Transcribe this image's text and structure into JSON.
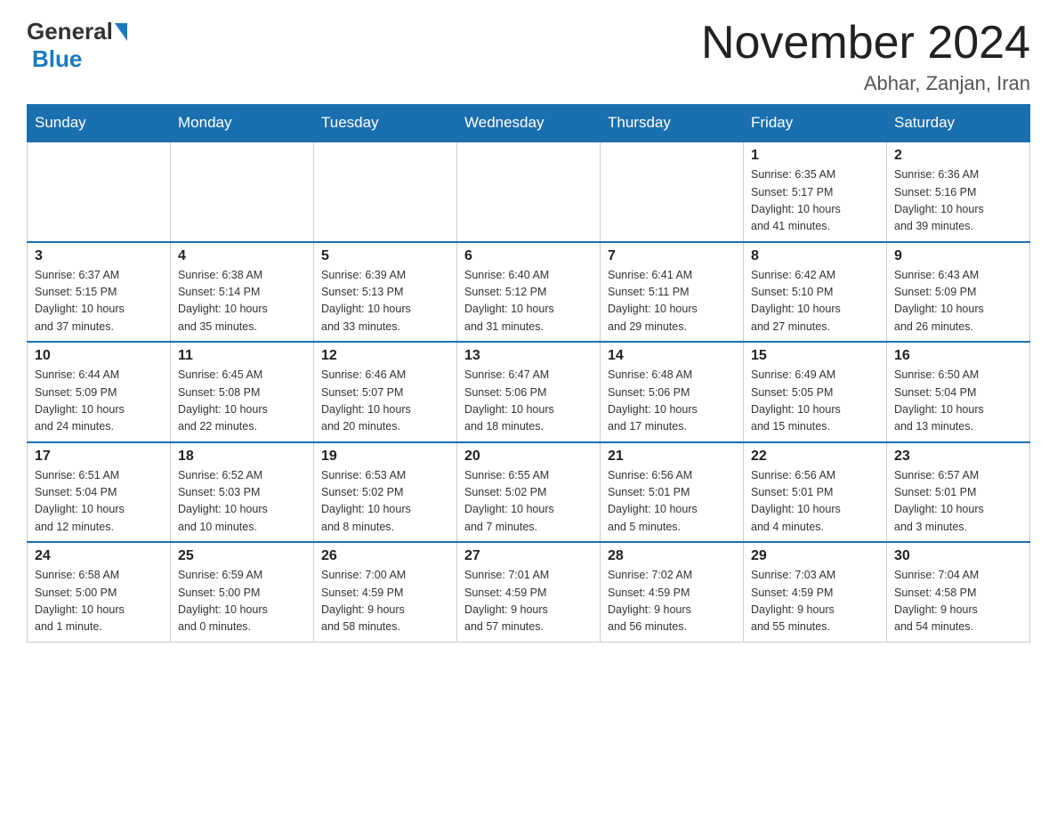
{
  "header": {
    "logo_general": "General",
    "logo_blue": "Blue",
    "month_year": "November 2024",
    "location": "Abhar, Zanjan, Iran"
  },
  "weekdays": [
    "Sunday",
    "Monday",
    "Tuesday",
    "Wednesday",
    "Thursday",
    "Friday",
    "Saturday"
  ],
  "weeks": [
    [
      {
        "day": "",
        "info": ""
      },
      {
        "day": "",
        "info": ""
      },
      {
        "day": "",
        "info": ""
      },
      {
        "day": "",
        "info": ""
      },
      {
        "day": "",
        "info": ""
      },
      {
        "day": "1",
        "info": "Sunrise: 6:35 AM\nSunset: 5:17 PM\nDaylight: 10 hours\nand 41 minutes."
      },
      {
        "day": "2",
        "info": "Sunrise: 6:36 AM\nSunset: 5:16 PM\nDaylight: 10 hours\nand 39 minutes."
      }
    ],
    [
      {
        "day": "3",
        "info": "Sunrise: 6:37 AM\nSunset: 5:15 PM\nDaylight: 10 hours\nand 37 minutes."
      },
      {
        "day": "4",
        "info": "Sunrise: 6:38 AM\nSunset: 5:14 PM\nDaylight: 10 hours\nand 35 minutes."
      },
      {
        "day": "5",
        "info": "Sunrise: 6:39 AM\nSunset: 5:13 PM\nDaylight: 10 hours\nand 33 minutes."
      },
      {
        "day": "6",
        "info": "Sunrise: 6:40 AM\nSunset: 5:12 PM\nDaylight: 10 hours\nand 31 minutes."
      },
      {
        "day": "7",
        "info": "Sunrise: 6:41 AM\nSunset: 5:11 PM\nDaylight: 10 hours\nand 29 minutes."
      },
      {
        "day": "8",
        "info": "Sunrise: 6:42 AM\nSunset: 5:10 PM\nDaylight: 10 hours\nand 27 minutes."
      },
      {
        "day": "9",
        "info": "Sunrise: 6:43 AM\nSunset: 5:09 PM\nDaylight: 10 hours\nand 26 minutes."
      }
    ],
    [
      {
        "day": "10",
        "info": "Sunrise: 6:44 AM\nSunset: 5:09 PM\nDaylight: 10 hours\nand 24 minutes."
      },
      {
        "day": "11",
        "info": "Sunrise: 6:45 AM\nSunset: 5:08 PM\nDaylight: 10 hours\nand 22 minutes."
      },
      {
        "day": "12",
        "info": "Sunrise: 6:46 AM\nSunset: 5:07 PM\nDaylight: 10 hours\nand 20 minutes."
      },
      {
        "day": "13",
        "info": "Sunrise: 6:47 AM\nSunset: 5:06 PM\nDaylight: 10 hours\nand 18 minutes."
      },
      {
        "day": "14",
        "info": "Sunrise: 6:48 AM\nSunset: 5:06 PM\nDaylight: 10 hours\nand 17 minutes."
      },
      {
        "day": "15",
        "info": "Sunrise: 6:49 AM\nSunset: 5:05 PM\nDaylight: 10 hours\nand 15 minutes."
      },
      {
        "day": "16",
        "info": "Sunrise: 6:50 AM\nSunset: 5:04 PM\nDaylight: 10 hours\nand 13 minutes."
      }
    ],
    [
      {
        "day": "17",
        "info": "Sunrise: 6:51 AM\nSunset: 5:04 PM\nDaylight: 10 hours\nand 12 minutes."
      },
      {
        "day": "18",
        "info": "Sunrise: 6:52 AM\nSunset: 5:03 PM\nDaylight: 10 hours\nand 10 minutes."
      },
      {
        "day": "19",
        "info": "Sunrise: 6:53 AM\nSunset: 5:02 PM\nDaylight: 10 hours\nand 8 minutes."
      },
      {
        "day": "20",
        "info": "Sunrise: 6:55 AM\nSunset: 5:02 PM\nDaylight: 10 hours\nand 7 minutes."
      },
      {
        "day": "21",
        "info": "Sunrise: 6:56 AM\nSunset: 5:01 PM\nDaylight: 10 hours\nand 5 minutes."
      },
      {
        "day": "22",
        "info": "Sunrise: 6:56 AM\nSunset: 5:01 PM\nDaylight: 10 hours\nand 4 minutes."
      },
      {
        "day": "23",
        "info": "Sunrise: 6:57 AM\nSunset: 5:01 PM\nDaylight: 10 hours\nand 3 minutes."
      }
    ],
    [
      {
        "day": "24",
        "info": "Sunrise: 6:58 AM\nSunset: 5:00 PM\nDaylight: 10 hours\nand 1 minute."
      },
      {
        "day": "25",
        "info": "Sunrise: 6:59 AM\nSunset: 5:00 PM\nDaylight: 10 hours\nand 0 minutes."
      },
      {
        "day": "26",
        "info": "Sunrise: 7:00 AM\nSunset: 4:59 PM\nDaylight: 9 hours\nand 58 minutes."
      },
      {
        "day": "27",
        "info": "Sunrise: 7:01 AM\nSunset: 4:59 PM\nDaylight: 9 hours\nand 57 minutes."
      },
      {
        "day": "28",
        "info": "Sunrise: 7:02 AM\nSunset: 4:59 PM\nDaylight: 9 hours\nand 56 minutes."
      },
      {
        "day": "29",
        "info": "Sunrise: 7:03 AM\nSunset: 4:59 PM\nDaylight: 9 hours\nand 55 minutes."
      },
      {
        "day": "30",
        "info": "Sunrise: 7:04 AM\nSunset: 4:58 PM\nDaylight: 9 hours\nand 54 minutes."
      }
    ]
  ]
}
